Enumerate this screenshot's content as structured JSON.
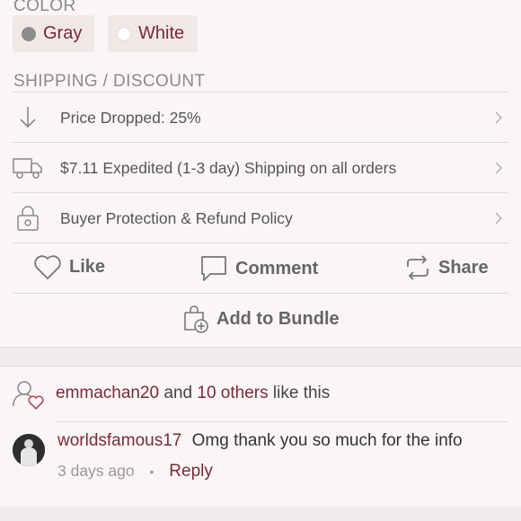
{
  "color": {
    "label": "COLOR",
    "options": [
      {
        "label": "Gray",
        "swatch": "#8c8c8c"
      },
      {
        "label": "White",
        "swatch": "#ffffff"
      }
    ]
  },
  "shipping": {
    "label": "SHIPPING / DISCOUNT",
    "rows": [
      {
        "text": "Price Dropped: 25%",
        "icon": "arrow-down-icon"
      },
      {
        "text": "$7.11 Expedited (1-3 day) Shipping on all orders",
        "icon": "truck-icon"
      },
      {
        "text": "Buyer Protection & Refund Policy",
        "icon": "lock-icon"
      }
    ]
  },
  "actions": {
    "like": "Like",
    "comment": "Comment",
    "share": "Share",
    "bundle": "Add to Bundle"
  },
  "likes": {
    "user": "emmachan20",
    "and": "and",
    "others": "10 others",
    "suffix": "like this"
  },
  "comment": {
    "user": "worldsfamous17",
    "text": "Omg thank you so much for the info",
    "time": "3 days ago",
    "sep": "•",
    "reply": "Reply"
  },
  "colors": {
    "accent": "#7a2a3a",
    "background": "#faf6f6",
    "chip": "#efe8e6"
  }
}
